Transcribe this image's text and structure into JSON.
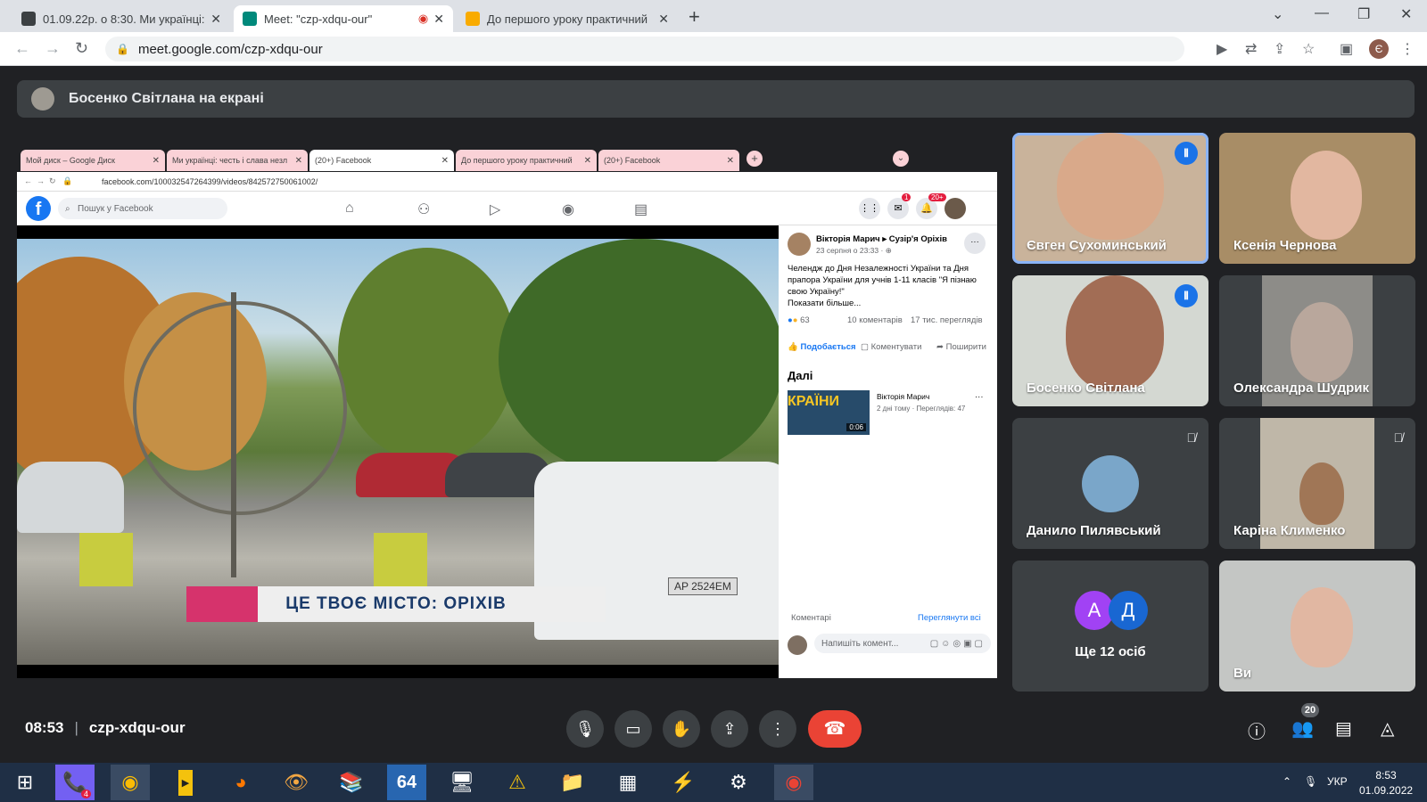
{
  "browser": {
    "tabs": [
      {
        "title": "01.09.22р. о 8:30. Ми українці: ч",
        "color": "#3c4043"
      },
      {
        "title": "Meet: \"czp-xdqu-our\"",
        "color": "#00897b"
      },
      {
        "title": "До першого уроку практичний",
        "color": "#f9ab00"
      }
    ],
    "url": "meet.google.com/czp-xdqu-our",
    "profile_initial": "Є"
  },
  "meet": {
    "presenter_banner": "Босенко Світлана на екрані",
    "time": "08:53",
    "code": "czp-xdqu-our",
    "people_count": "20",
    "participants": [
      {
        "name": "Євген Сухоминський",
        "speaking": true
      },
      {
        "name": "Ксенія Чернова",
        "speaking": false
      },
      {
        "name": "Босенко Світлана",
        "speaking": true
      },
      {
        "name": "Олександра Шудрик",
        "speaking": false
      },
      {
        "name": "Данило Пилявський",
        "muted": true
      },
      {
        "name": "Каріна Клименко",
        "muted": true
      },
      {
        "name": "Ще 12 осіб",
        "initials": [
          "А",
          "Д"
        ]
      },
      {
        "name": "Ви"
      }
    ]
  },
  "shared": {
    "tabs": [
      "Мой диск – Google Диск",
      "Ми українці: честь і слава незл",
      "(20+) Facebook",
      "До першого уроку практичний",
      "(20+) Facebook"
    ],
    "url": "facebook.com/100032547264399/videos/842572750061002/",
    "fb_search": "Пошук у Facebook",
    "notif_badge": "1",
    "notif_badge2": "20+",
    "post_author": "Вікторія Марич ▸ Сузір'я Оріхів",
    "post_date": "23 серпня о 23:33 · ",
    "post_text": "Челендж до Дня Незалежності України та Дня прапора України для учнів 1-11 класів \"Я пізнаю свою Україну!\"",
    "show_more": "Показати більше...",
    "reactions": "63",
    "comments": "10 коментарів",
    "views": "17 тис. переглядів",
    "like": "Подобається",
    "comment": "Коментувати",
    "share": "Поширити",
    "next_label": "Далі",
    "next_author": "Вікторія Марич",
    "next_meta": "2 дні тому · Переглядів: 47",
    "next_thumb_text": "КРАЇНИ",
    "next_dur": "0:06",
    "comments_label": "Коментарі",
    "view_all": "Переглянути всі",
    "comment_placeholder": "Напишіть комент...",
    "video_banner": "ЦЕ ТВОЄ МІСТО: ОРІХІВ",
    "plate": "AP 2524EM"
  },
  "taskbar": {
    "lang": "УКР",
    "time": "8:53",
    "date": "01.09.2022",
    "viber_badge": "4",
    "app_64": "64"
  }
}
